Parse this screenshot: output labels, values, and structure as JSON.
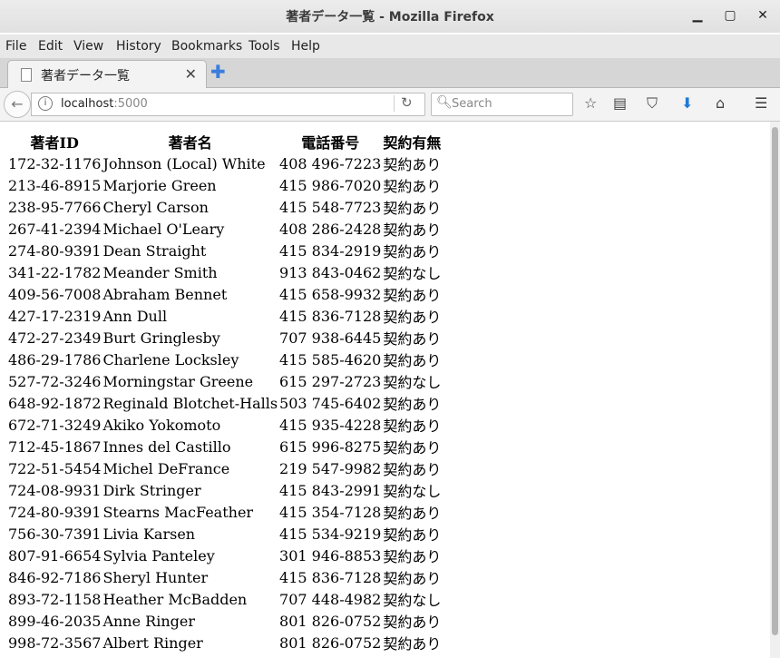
{
  "window": {
    "title": "著者データ一覧 - Mozilla Firefox"
  },
  "menu": [
    "File",
    "Edit",
    "View",
    "History",
    "Bookmarks",
    "Tools",
    "Help"
  ],
  "tab": {
    "label": "著者データ一覧"
  },
  "urlbar": {
    "host": "localhost",
    "port": ":5000"
  },
  "search": {
    "placeholder": "Search"
  },
  "table": {
    "headers": [
      "著者ID",
      "著者名",
      "電話番号",
      "契約有無"
    ],
    "rows": [
      [
        "172-32-1176",
        "Johnson (Local) White",
        "408 496-7223",
        "契約あり"
      ],
      [
        "213-46-8915",
        "Marjorie Green",
        "415 986-7020",
        "契約あり"
      ],
      [
        "238-95-7766",
        "Cheryl Carson",
        "415 548-7723",
        "契約あり"
      ],
      [
        "267-41-2394",
        "Michael O'Leary",
        "408 286-2428",
        "契約あり"
      ],
      [
        "274-80-9391",
        "Dean Straight",
        "415 834-2919",
        "契約あり"
      ],
      [
        "341-22-1782",
        "Meander Smith",
        "913 843-0462",
        "契約なし"
      ],
      [
        "409-56-7008",
        "Abraham Bennet",
        "415 658-9932",
        "契約あり"
      ],
      [
        "427-17-2319",
        "Ann Dull",
        "415 836-7128",
        "契約あり"
      ],
      [
        "472-27-2349",
        "Burt Gringlesby",
        "707 938-6445",
        "契約あり"
      ],
      [
        "486-29-1786",
        "Charlene Locksley",
        "415 585-4620",
        "契約あり"
      ],
      [
        "527-72-3246",
        "Morningstar Greene",
        "615 297-2723",
        "契約なし"
      ],
      [
        "648-92-1872",
        "Reginald Blotchet-Halls",
        "503 745-6402",
        "契約あり"
      ],
      [
        "672-71-3249",
        "Akiko Yokomoto",
        "415 935-4228",
        "契約あり"
      ],
      [
        "712-45-1867",
        "Innes del Castillo",
        "615 996-8275",
        "契約あり"
      ],
      [
        "722-51-5454",
        "Michel DeFrance",
        "219 547-9982",
        "契約あり"
      ],
      [
        "724-08-9931",
        "Dirk Stringer",
        "415 843-2991",
        "契約なし"
      ],
      [
        "724-80-9391",
        "Stearns MacFeather",
        "415 354-7128",
        "契約あり"
      ],
      [
        "756-30-7391",
        "Livia Karsen",
        "415 534-9219",
        "契約あり"
      ],
      [
        "807-91-6654",
        "Sylvia Panteley",
        "301 946-8853",
        "契約あり"
      ],
      [
        "846-92-7186",
        "Sheryl Hunter",
        "415 836-7128",
        "契約あり"
      ],
      [
        "893-72-1158",
        "Heather McBadden",
        "707 448-4982",
        "契約なし"
      ],
      [
        "899-46-2035",
        "Anne Ringer",
        "801 826-0752",
        "契約あり"
      ],
      [
        "998-72-3567",
        "Albert Ringer",
        "801 826-0752",
        "契約あり"
      ]
    ]
  }
}
